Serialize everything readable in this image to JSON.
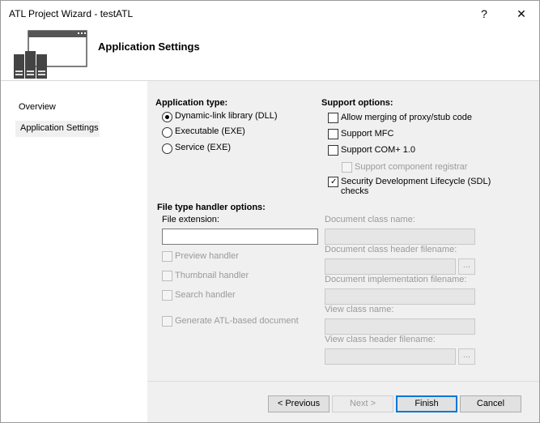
{
  "window": {
    "title": "ATL Project Wizard - testATL",
    "help_glyph": "?",
    "close_glyph": "✕"
  },
  "header": {
    "title": "Application Settings",
    "icon": "wizard-server-window-icon"
  },
  "nav": {
    "items": [
      "Overview",
      "Application Settings"
    ],
    "selected": "Application Settings"
  },
  "application_type": {
    "label": "Application type:",
    "options": [
      "Dynamic-link library (DLL)",
      "Executable (EXE)",
      "Service (EXE)"
    ],
    "selected": "Dynamic-link library (DLL)"
  },
  "support_options": {
    "label": "Support options:",
    "allow_merging": "Allow merging of proxy/stub code",
    "support_mfc": "Support MFC",
    "support_com": "Support COM+ 1.0",
    "support_component_registrar": "Support component registrar",
    "sdl_line1": "Security Development Lifecycle (SDL)",
    "sdl_line2": "checks",
    "sdl_checked": true
  },
  "file_type": {
    "label": "File type handler options:",
    "file_extension_label": "File extension:",
    "file_extension_value": "",
    "preview_handler": "Preview handler",
    "thumbnail_handler": "Thumbnail handler",
    "search_handler": "Search handler",
    "generate_doc": "Generate ATL-based document",
    "doc_class_name": "Document class name:",
    "doc_class_header": "Document class header filename:",
    "doc_impl": "Document implementation filename:",
    "view_class_name": "View class name:",
    "view_class_header": "View class header filename:",
    "browse_label": "..."
  },
  "buttons": {
    "previous": "< Previous",
    "next": "Next >",
    "finish": "Finish",
    "cancel": "Cancel"
  }
}
